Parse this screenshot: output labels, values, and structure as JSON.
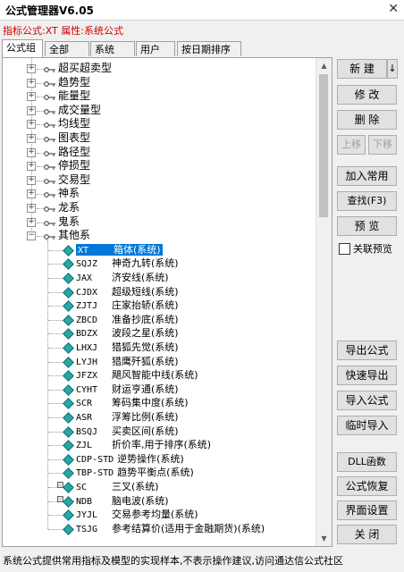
{
  "window": {
    "title": "公式管理器V6.05"
  },
  "indicator_line": "指标公式:XT 属性:系统公式",
  "tabs": [
    "公式组",
    "全部",
    "系统",
    "用户",
    "按日期排序"
  ],
  "tree": {
    "groups": [
      {
        "label": "超买超卖型"
      },
      {
        "label": "趋势型"
      },
      {
        "label": "能量型"
      },
      {
        "label": "成交量型"
      },
      {
        "label": "均线型"
      },
      {
        "label": "图表型"
      },
      {
        "label": "路径型"
      },
      {
        "label": "停损型"
      },
      {
        "label": "交易型"
      },
      {
        "label": "神系"
      },
      {
        "label": "龙系"
      },
      {
        "label": "鬼系"
      },
      {
        "label": "其他系"
      }
    ],
    "items": [
      {
        "code": "XT",
        "name": "箱体(系统)",
        "selected": true
      },
      {
        "code": "SQJZ",
        "name": "神奇九转(系统)"
      },
      {
        "code": "JAX",
        "name": "济安线(系统)"
      },
      {
        "code": "CJDX",
        "name": "超级短线(系统)"
      },
      {
        "code": "ZJTJ",
        "name": "庄家抬轿(系统)"
      },
      {
        "code": "ZBCD",
        "name": "准备抄底(系统)"
      },
      {
        "code": "BDZX",
        "name": "波段之星(系统)"
      },
      {
        "code": "LHXJ",
        "name": "猎狐先觉(系统)"
      },
      {
        "code": "LYJH",
        "name": "猎鹰歼狐(系统)"
      },
      {
        "code": "JFZX",
        "name": "飓风智能中线(系统)"
      },
      {
        "code": "CYHT",
        "name": "财运亨通(系统)"
      },
      {
        "code": "SCR",
        "name": "筹码集中度(系统)"
      },
      {
        "code": "ASR",
        "name": "浮筹比例(系统)"
      },
      {
        "code": "BSQJ",
        "name": "买卖区间(系统)"
      },
      {
        "code": "ZJL",
        "name": "折价率,用于排序(系统)"
      },
      {
        "code": "CDP-STD",
        "name": "逆势操作(系统)"
      },
      {
        "code": "TBP-STD",
        "name": "趋势平衡点(系统)"
      },
      {
        "code": "SC",
        "name": "三叉(系统)",
        "locked": true
      },
      {
        "code": "NDB",
        "name": "脑电波(系统)",
        "locked": true
      },
      {
        "code": "JYJL",
        "name": "交易参考均量(系统)"
      },
      {
        "code": "TSJG",
        "name": "参考结算价(适用于金融期货)(系统)"
      }
    ]
  },
  "buttons": {
    "new": "新 建",
    "new_arrow": "↓",
    "modify": "修 改",
    "delete": "删 除",
    "move_up": "上移",
    "move_down": "下移",
    "add_common": "加入常用",
    "find": "查找(F3)",
    "preview": "预 览",
    "export": "导出公式",
    "quick_export": "快速导出",
    "import": "导入公式",
    "temp_import": "临时导入",
    "dll": "DLL函数",
    "restore": "公式恢复",
    "ui_settings": "界面设置",
    "close": "关 闭"
  },
  "link_preview_label": "关联预览",
  "close_glyph": "✕",
  "status_bar": "系统公式提供常用指标及模型的实现样本,不表示操作建议,访问通达信公式社区"
}
